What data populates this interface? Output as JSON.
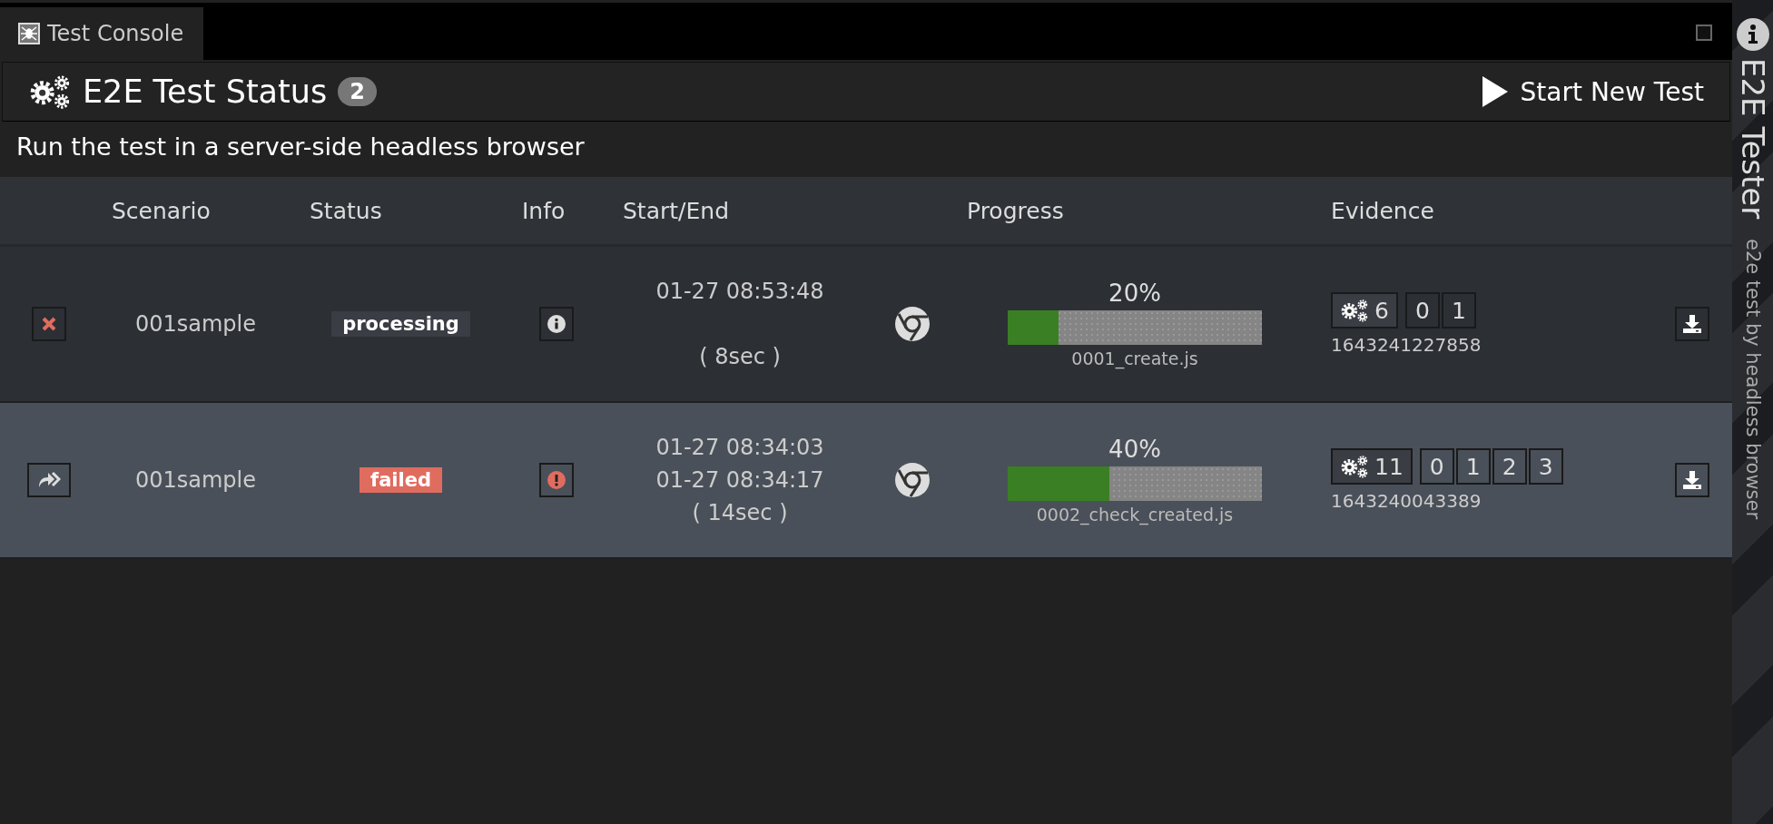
{
  "tab": {
    "label": "Test Console",
    "selected": true
  },
  "header": {
    "title": "E2E Test Status",
    "count": "2",
    "action": "Start New Test"
  },
  "subtitle": "Run the test in a server-side headless browser",
  "table": {
    "columns": [
      "Scenario",
      "Status",
      "Info",
      "Start/End",
      "Progress",
      "Evidence"
    ],
    "rows": [
      {
        "selected": false,
        "action": {
          "kind": "cancel"
        },
        "scenario": "001sample",
        "status": {
          "label": "processing",
          "kind": "processing"
        },
        "info": {
          "kind": "info"
        },
        "start": "01-27 08:53:48",
        "duration": "( 8sec )",
        "level": 0.2,
        "percent": "20%",
        "file": "0001_create.js",
        "steps": "6",
        "shots": [
          "0",
          "1"
        ],
        "run_id": "1643241227858"
      },
      {
        "selected": true,
        "action": {
          "kind": "rerun"
        },
        "scenario": "001sample",
        "status": {
          "label": "failed",
          "kind": "failed"
        },
        "info": {
          "kind": "error"
        },
        "start": "01-27 08:34:03",
        "end": "01-27 08:34:17",
        "duration": "( 14sec )",
        "level": 0.4,
        "percent": "40%",
        "file": "0002_check_created.js",
        "steps": "11",
        "shots": [
          "0",
          "1",
          "2",
          "3"
        ],
        "run_id": "1643240043389"
      }
    ]
  },
  "sidebar": {
    "title": "E2E Tester",
    "subtitle": "e2e test by headless browser"
  }
}
